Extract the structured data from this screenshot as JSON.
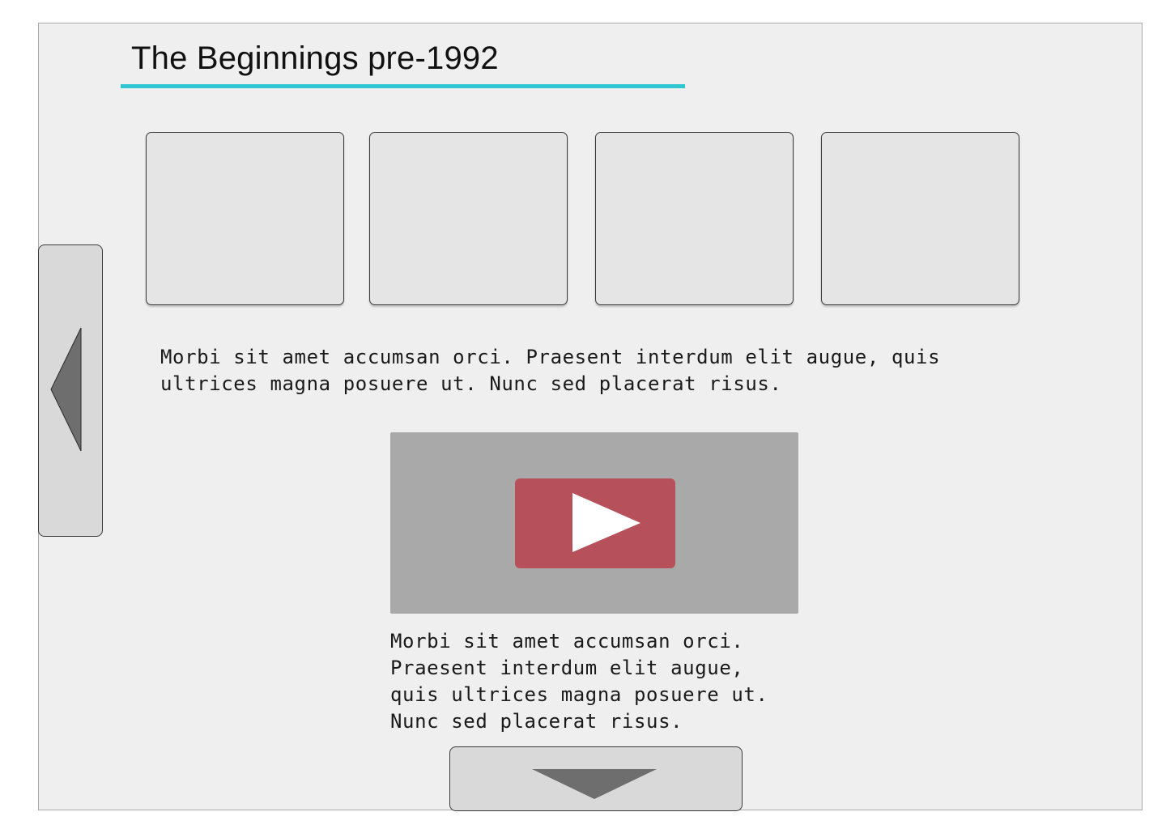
{
  "page": {
    "title": "The Beginnings pre-1992",
    "accent_color": "#2fc6d2"
  },
  "gallery": {
    "items": [
      {
        "label": ""
      },
      {
        "label": ""
      },
      {
        "label": ""
      },
      {
        "label": ""
      }
    ]
  },
  "intro": {
    "text": "Morbi sit amet accumsan orci. Praesent interdum elit augue, quis\nultrices magna posuere ut. Nunc sed placerat risus."
  },
  "video": {
    "play_icon": "play-icon",
    "button_color": "#b6505a"
  },
  "caption": {
    "text": "Morbi sit amet accumsan orci.\nPraesent interdum elit augue,\nquis ultrices magna posuere ut.\nNunc sed placerat risus."
  },
  "navigation": {
    "previous_icon": "arrow-left-icon",
    "next_icon": "arrow-down-icon"
  }
}
